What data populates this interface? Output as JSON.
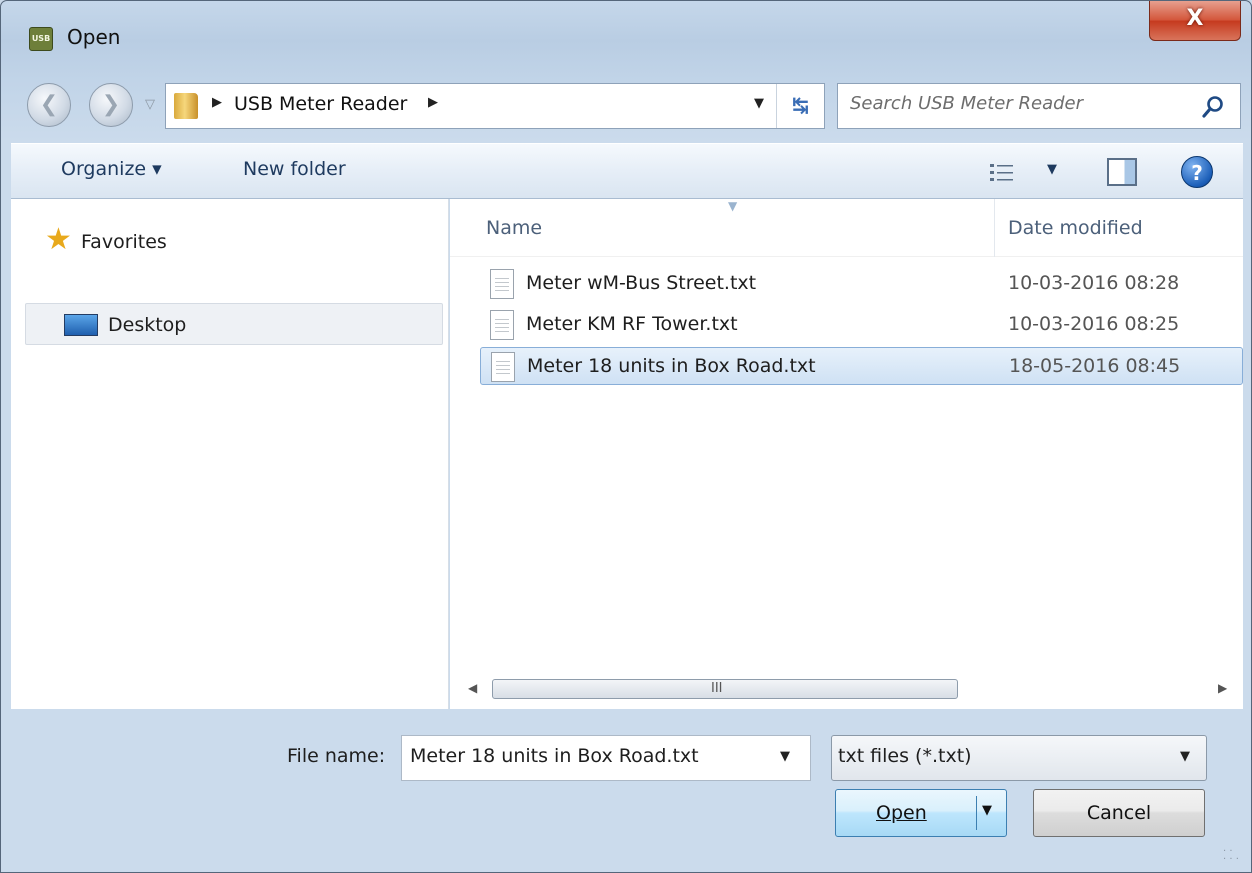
{
  "window": {
    "app_icon_text": "USB",
    "title": "Open",
    "close_symbol": "X"
  },
  "navigation": {
    "back_symbol": "❮",
    "forward_symbol": "❯",
    "breadcrumb": [
      "USB Meter Reader"
    ],
    "search_placeholder": "Search USB Meter Reader"
  },
  "toolbar": {
    "organize_label": "Organize ▾",
    "new_folder_label": "New folder",
    "help_symbol": "?"
  },
  "nav_pane": {
    "favorites_label": "Favorites",
    "desktop_label": "Desktop"
  },
  "file_list": {
    "columns": {
      "name": "Name",
      "date": "Date modified"
    },
    "files": [
      {
        "name": "Meter wM-Bus Street.txt",
        "date": "10-03-2016 08:28"
      },
      {
        "name": "Meter KM RF Tower.txt",
        "date": "10-03-2016 08:25"
      },
      {
        "name": "Meter 18 units in Box Road.txt",
        "date": "18-05-2016 08:45"
      }
    ],
    "selected_index": 2,
    "scroll_grip": "III"
  },
  "bottom": {
    "filename_label": "File name:",
    "filename_value": "Meter 18 units in Box Road.txt",
    "filetype_value": "txt files (*.txt)",
    "open_label": "Open",
    "cancel_label": "Cancel"
  },
  "colors": {
    "selection": "#cfe1f4",
    "close_red": "#c63a1f",
    "link_blue": "#1e3a5f"
  }
}
